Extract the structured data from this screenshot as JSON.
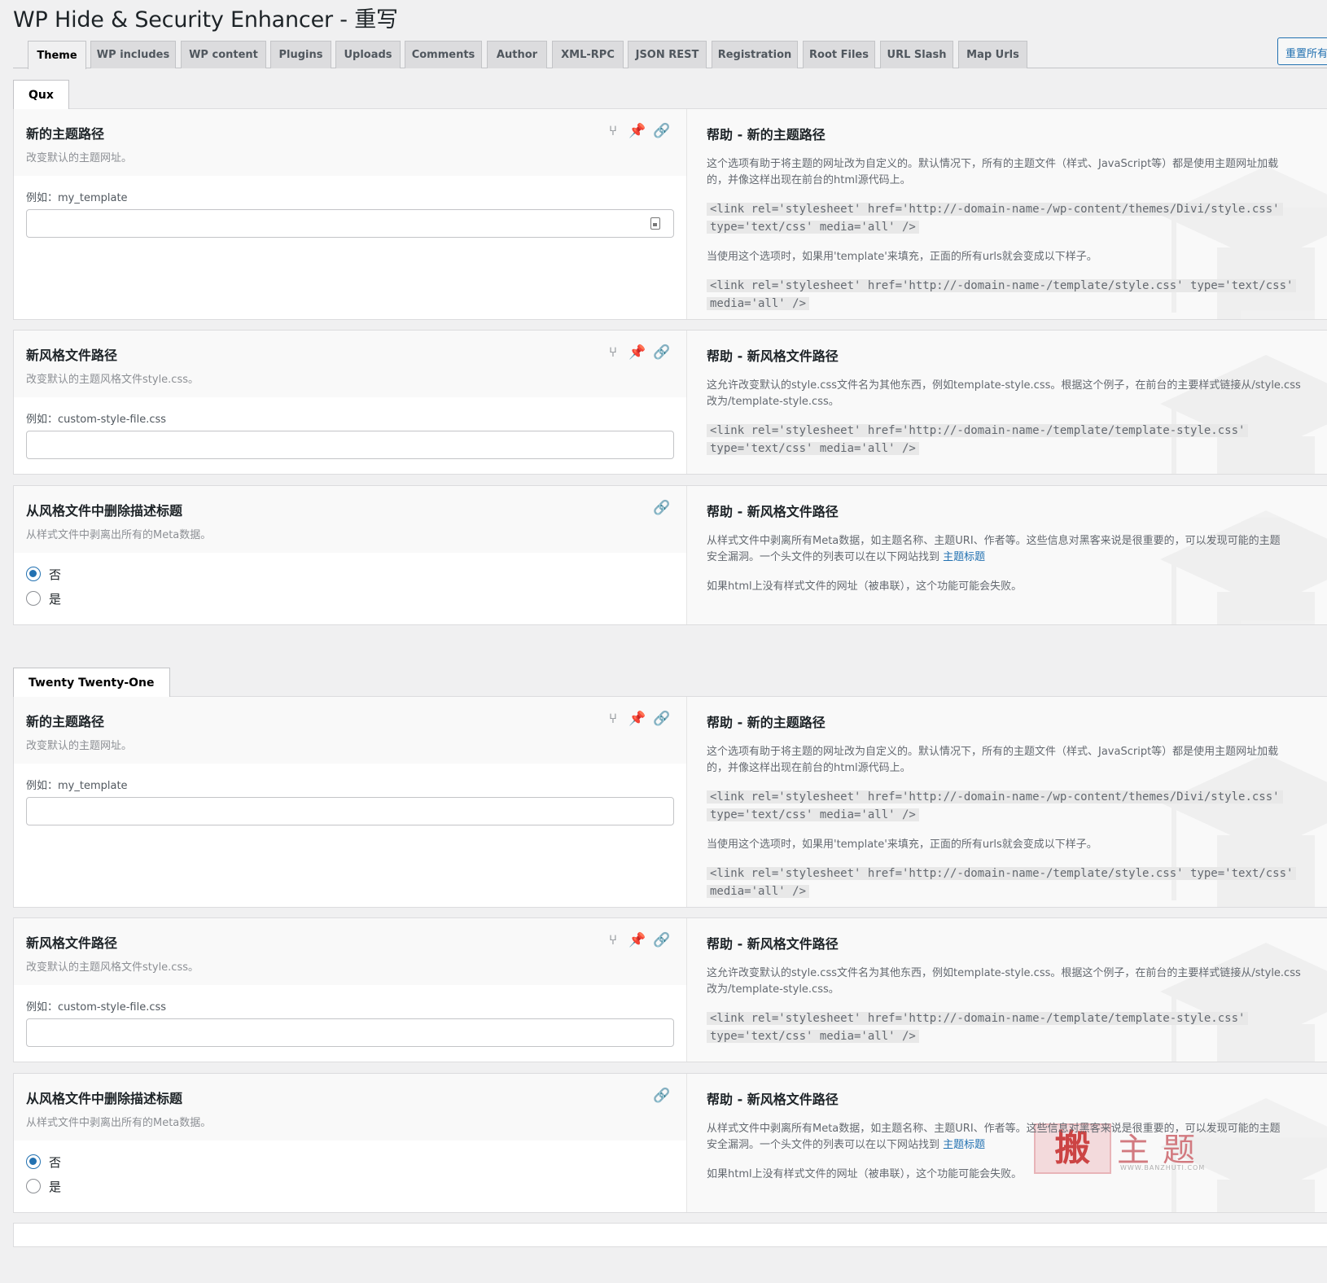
{
  "page_title": "WP Hide & Security Enhancer - 重写",
  "reset_button": "重置所有",
  "tabs": [
    "Theme",
    "WP includes",
    "WP content",
    "Plugins",
    "Uploads",
    "Comments",
    "Author",
    "XML-RPC",
    "JSON REST",
    "Registration",
    "Root Files",
    "URL Slash",
    "Map Urls"
  ],
  "sections": [
    {
      "theme_name": "Qux",
      "options": [
        {
          "title": "新的主题路径",
          "desc": "改变默认的主题网址。",
          "example": "例如：my_template",
          "help_title": "帮助 - 新的主题路径",
          "help_p1_line1": "这个选项有助于将主题的网址改为自定义的。默认情况下，所有的主题文件（样式、JavaScript等）都是使用主题网址加载",
          "help_p1_line2": "的，并像这样出现在前台的html源代码上。",
          "help_code1_line1": "<link rel='stylesheet' href='http://-domain-name-/wp-content/themes/Divi/style.css'",
          "help_code1_line2": "type='text/css' media='all' />",
          "help_p2": "当使用这个选项时，如果用'template'来填充，正面的所有urls就会变成以下样子。",
          "help_code2_line1": "<link rel='stylesheet' href='http://-domain-name-/template/style.css' type='text/css'",
          "help_code2_line2": "media='all' />"
        },
        {
          "title": "新风格文件路径",
          "desc": "改变默认的主题风格文件style.css。",
          "example": "例如：custom-style-file.css",
          "help_title": "帮助 - 新风格文件路径",
          "help_p1_line1": "这允许改变默认的style.css文件名为其他东西，例如template-style.css。根据这个例子，在前台的主要样式链接从/style.css",
          "help_p1_line2": "改为/template-style.css。",
          "help_code1_line1": "<link rel='stylesheet' href='http://-domain-name-/template/template-style.css'",
          "help_code1_line2": "type='text/css' media='all' />"
        },
        {
          "title": "从风格文件中删除描述标题",
          "desc": "从样式文件中剥离出所有的Meta数据。",
          "radio_no": "否",
          "radio_yes": "是",
          "help_title": "帮助 - 新风格文件路径",
          "help_p1_line1": "从样式文件中剥离所有Meta数据，如主题名称、主题URI、作者等。这些信息对黑客来说是很重要的，可以发现可能的主题",
          "help_p1_line2a": "安全漏洞。一个头文件的列表可以在以下网站找到",
          "help_link": "主题标题",
          "help_p2": "如果html上没有样式文件的网址（被串联），这个功能可能会失败。"
        }
      ]
    },
    {
      "theme_name": "Twenty Twenty-One",
      "options": [
        {
          "title": "新的主题路径",
          "desc": "改变默认的主题网址。",
          "example": "例如：my_template",
          "help_title": "帮助 - 新的主题路径",
          "help_p1_line1": "这个选项有助于将主题的网址改为自定义的。默认情况下，所有的主题文件（样式、JavaScript等）都是使用主题网址加载",
          "help_p1_line2": "的，并像这样出现在前台的html源代码上。",
          "help_code1_line1": "<link rel='stylesheet' href='http://-domain-name-/wp-content/themes/Divi/style.css'",
          "help_code1_line2": "type='text/css' media='all' />",
          "help_p2": "当使用这个选项时，如果用'template'来填充，正面的所有urls就会变成以下样子。",
          "help_code2_line1": "<link rel='stylesheet' href='http://-domain-name-/template/style.css' type='text/css'",
          "help_code2_line2": "media='all' />"
        },
        {
          "title": "新风格文件路径",
          "desc": "改变默认的主题风格文件style.css。",
          "example": "例如：custom-style-file.css",
          "help_title": "帮助 - 新风格文件路径",
          "help_p1_line1": "这允许改变默认的style.css文件名为其他东西，例如template-style.css。根据这个例子，在前台的主要样式链接从/style.css",
          "help_p1_line2": "改为/template-style.css。",
          "help_code1_line1": "<link rel='stylesheet' href='http://-domain-name-/template/template-style.css'",
          "help_code1_line2": "type='text/css' media='all' />"
        },
        {
          "title": "从风格文件中删除描述标题",
          "desc": "从样式文件中剥离出所有的Meta数据。",
          "radio_no": "否",
          "radio_yes": "是",
          "help_title": "帮助 - 新风格文件路径",
          "help_p1_line1": "从样式文件中剥离所有Meta数据，如主题名称、主题URI、作者等。这些信息对黑客来说是很重要的，可以发现可能的主题",
          "help_p1_line2a": "安全漏洞。一个头文件的列表可以在以下网站找到",
          "help_link": "主题标题",
          "help_p2": "如果html上没有样式文件的网址（被串联），这个功能可能会失败。"
        }
      ]
    }
  ],
  "watermark": {
    "brand_char": "搬",
    "brand_text": "主题",
    "brand_url": "WWW.BANZHUTI.COM"
  },
  "icons": [
    "split-icon",
    "pin-icon",
    "link-icon",
    "clipboard-icon"
  ],
  "colors": {
    "accent": "#2271b1",
    "link": "#2271b1",
    "page_bg": "#f0f0f1"
  }
}
